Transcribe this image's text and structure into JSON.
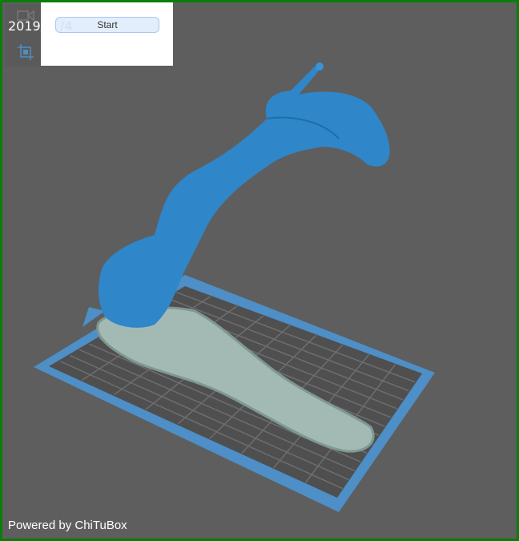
{
  "viewport": {
    "date_left": "2019/",
    "date_right": "/4",
    "footer": "Powered by ChiTuBox"
  },
  "panel": {
    "start_label": "Start"
  },
  "colors": {
    "frame": "#0b7d0b",
    "background": "#5e5e5e",
    "model": "#2f85c8",
    "plate_border": "#4a8fc9",
    "raft": "#9fb6b0"
  }
}
